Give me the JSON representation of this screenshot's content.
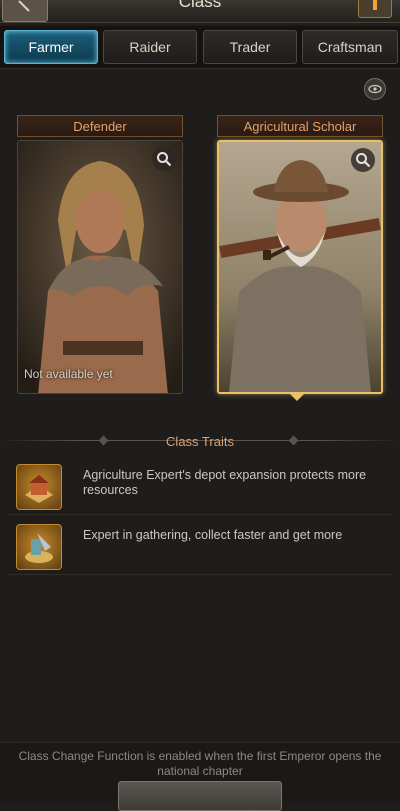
{
  "header": {
    "title": "Class"
  },
  "tabs": [
    {
      "label": "Farmer",
      "active": true
    },
    {
      "label": "Raider",
      "active": false
    },
    {
      "label": "Trader",
      "active": false
    },
    {
      "label": "Craftsman",
      "active": false
    }
  ],
  "cards": [
    {
      "label": "Defender",
      "note": "Not available yet",
      "selected": false
    },
    {
      "label": "Agricultural Scholar",
      "note": "",
      "selected": true
    }
  ],
  "traits": {
    "title": "Class Traits",
    "items": [
      {
        "text": "Agriculture Expert's depot expansion protects more resources",
        "icon": "depot-icon"
      },
      {
        "text": "Expert in gathering, collect faster and get more",
        "icon": "gathering-icon"
      }
    ]
  },
  "footer": {
    "notice": "Class Change Function is enabled when the first Emperor opens the national chapter"
  },
  "colors": {
    "accent_orange": "#e2a26a",
    "tab_active": "#1b5f7a",
    "selected_border": "#e9c267"
  }
}
